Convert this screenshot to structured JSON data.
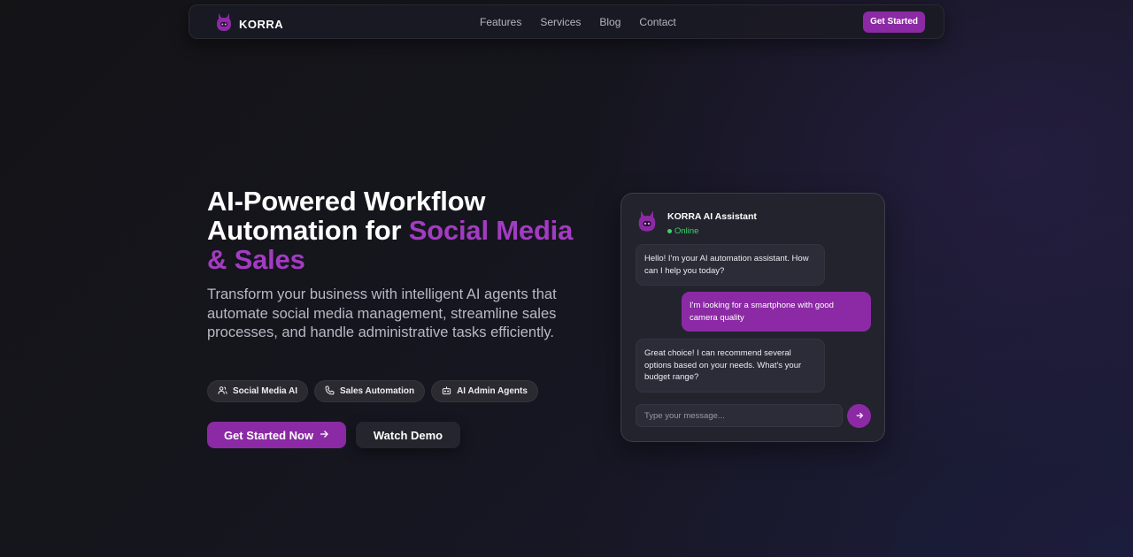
{
  "brand": {
    "name": "KORRA"
  },
  "nav": {
    "links": [
      "Features",
      "Services",
      "Blog",
      "Contact"
    ],
    "cta_label": "Get Started"
  },
  "hero": {
    "title_part1": "AI-Powered Workflow Automation for ",
    "title_accent": "Social Media & Sales",
    "subtitle": "Transform your business with intelligent AI agents that automate social media management, streamline sales processes, and handle administrative tasks efficiently.",
    "tags": [
      {
        "label": "Social Media AI",
        "icon": "users-icon"
      },
      {
        "label": "Sales Automation",
        "icon": "phone-icon"
      },
      {
        "label": "AI Admin Agents",
        "icon": "robot-icon"
      }
    ],
    "primary_cta": "Get Started Now",
    "secondary_cta": "Watch Demo"
  },
  "chat": {
    "title": "KORRA AI Assistant",
    "status": "Online",
    "messages": [
      {
        "from": "bot",
        "text": "Hello! I'm your AI automation assistant. How can I help you today?"
      },
      {
        "from": "user",
        "text": "I'm looking for a smartphone with good camera quality"
      },
      {
        "from": "bot",
        "text": "Great choice! I can recommend several options based on your needs. What's your budget range?"
      }
    ],
    "input_placeholder": "Type your message..."
  },
  "colors": {
    "accent": "#8b2aa4",
    "accent_text": "#a33bc3",
    "online": "#3dd36b",
    "background": "#15151d"
  }
}
